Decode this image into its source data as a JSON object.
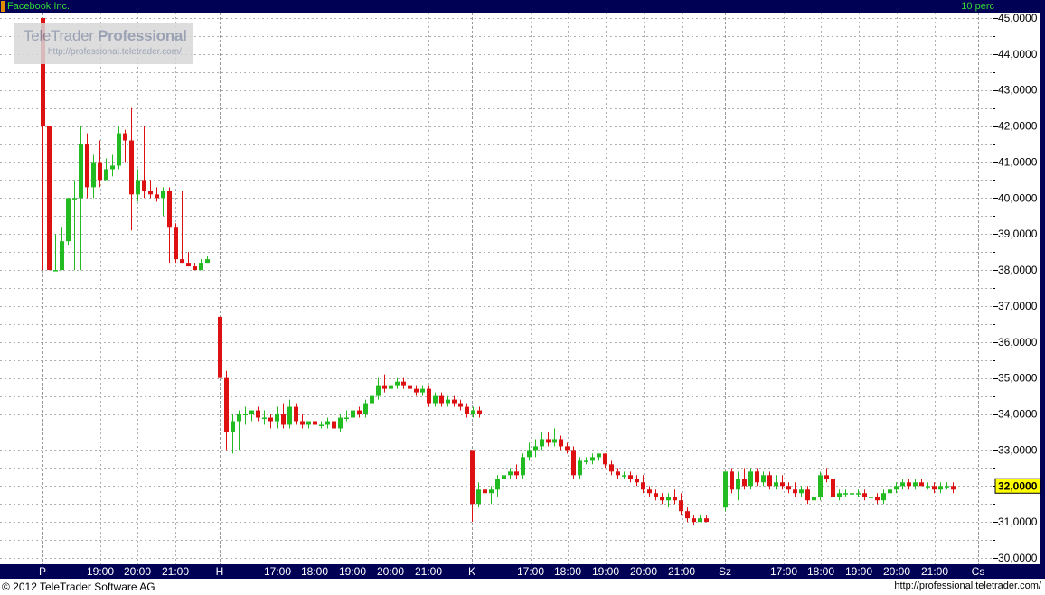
{
  "window": {
    "title": "Facebook Inc.",
    "scale_label": "10 perc",
    "copyright": "© 2012 TeleTrader Software AG",
    "site_url": "http://professional.teletrader.com/"
  },
  "watermark": {
    "brand": "TeleTrader",
    "brand_bold": "Professional",
    "url": "http://professional.teletrader.com/"
  },
  "colors": {
    "up": "#22bb22",
    "down": "#dd1111",
    "frame": "#000055",
    "grid": "#b0b0b0",
    "title_text": "#33dd33"
  },
  "chart_data": {
    "type": "candlestick",
    "title": "Facebook Inc.",
    "interval": "10 perc",
    "ylim": [
      30,
      45
    ],
    "y_ticks": [
      "30,0000",
      "31,0000",
      "32,0000",
      "33,0000",
      "34,0000",
      "35,0000",
      "36,0000",
      "37,0000",
      "38,0000",
      "39,0000",
      "40,0000",
      "41,0000",
      "42,0000",
      "43,0000",
      "44,0000",
      "45,0000"
    ],
    "last_price_label": "32,0000",
    "last_price": 32.0,
    "grid": true,
    "x_labels": [
      "P",
      "19:00",
      "20:00",
      "21:00",
      "H",
      "17:00",
      "18:00",
      "19:00",
      "20:00",
      "21:00",
      "K",
      "17:00",
      "18:00",
      "19:00",
      "20:00",
      "21:00",
      "Sz",
      "17:00",
      "18:00",
      "19:00",
      "20:00",
      "21:00",
      "Cs"
    ],
    "session_dividers": [
      "P",
      "H",
      "K",
      "Sz",
      "Cs"
    ],
    "sessions": [
      {
        "start_label": "P",
        "first_index": 0,
        "candles": [
          [
            45.0,
            45.0,
            38.0,
            42.0
          ],
          [
            42.0,
            42.0,
            38.0,
            38.0
          ],
          [
            38.0,
            39.0,
            38.0,
            38.0
          ],
          [
            38.0,
            39.2,
            38.0,
            38.8
          ],
          [
            38.8,
            40.0,
            38.7,
            40.0
          ],
          [
            40.0,
            40.5,
            38.0,
            40.0
          ],
          [
            40.0,
            42.0,
            38.0,
            41.5
          ],
          [
            41.5,
            41.8,
            40.0,
            40.3
          ],
          [
            40.3,
            41.2,
            40.0,
            41.0
          ],
          [
            41.0,
            41.6,
            40.3,
            40.5
          ],
          [
            40.5,
            41.1,
            40.6,
            40.8
          ],
          [
            40.8,
            41.2,
            40.6,
            40.9
          ],
          [
            40.9,
            42.0,
            40.8,
            41.8
          ],
          [
            41.8,
            41.9,
            41.0,
            41.6
          ],
          [
            41.6,
            42.5,
            39.1,
            40.1
          ],
          [
            40.1,
            40.8,
            39.9,
            40.5
          ],
          [
            40.5,
            42.0,
            40.0,
            40.2
          ],
          [
            40.2,
            40.5,
            40.0,
            40.1
          ],
          [
            40.1,
            40.3,
            39.9,
            40.0
          ],
          [
            40.0,
            40.3,
            39.5,
            40.2
          ],
          [
            40.2,
            40.3,
            38.2,
            39.2
          ],
          [
            39.2,
            39.3,
            38.2,
            38.3
          ],
          [
            38.3,
            40.2,
            38.2,
            38.2
          ],
          [
            38.2,
            38.5,
            38.1,
            38.1
          ],
          [
            38.1,
            38.2,
            38.0,
            38.0
          ],
          [
            38.0,
            38.3,
            38.0,
            38.2
          ],
          [
            38.2,
            38.4,
            38.2,
            38.3
          ]
        ]
      },
      {
        "start_label": "H",
        "first_index": 0,
        "candles": [
          [
            36.7,
            36.7,
            35.0,
            35.0
          ],
          [
            35.0,
            35.2,
            33.0,
            33.5
          ],
          [
            33.5,
            34.0,
            32.9,
            33.8
          ],
          [
            33.8,
            34.1,
            33.0,
            34.0
          ],
          [
            34.0,
            34.2,
            33.7,
            34.0
          ],
          [
            34.0,
            34.1,
            33.8,
            34.1
          ],
          [
            34.1,
            34.2,
            33.8,
            33.9
          ],
          [
            33.9,
            34.1,
            33.7,
            33.9
          ],
          [
            33.9,
            34.0,
            33.6,
            33.8
          ],
          [
            33.8,
            34.2,
            33.6,
            34.0
          ],
          [
            34.0,
            34.3,
            33.6,
            33.7
          ],
          [
            33.7,
            34.4,
            33.6,
            34.2
          ],
          [
            34.2,
            34.3,
            33.7,
            33.8
          ],
          [
            33.8,
            34.0,
            33.6,
            33.7
          ],
          [
            33.7,
            33.8,
            33.6,
            33.8
          ],
          [
            33.8,
            33.9,
            33.6,
            33.7
          ],
          [
            33.7,
            33.8,
            33.6,
            33.7
          ],
          [
            33.7,
            33.9,
            33.6,
            33.8
          ],
          [
            33.8,
            33.9,
            33.5,
            33.6
          ],
          [
            33.6,
            34.0,
            33.5,
            33.9
          ],
          [
            33.9,
            34.1,
            33.8,
            33.9
          ],
          [
            33.9,
            34.2,
            33.8,
            34.1
          ],
          [
            34.1,
            34.2,
            33.9,
            34.0
          ],
          [
            34.0,
            34.4,
            33.9,
            34.3
          ],
          [
            34.3,
            34.6,
            34.2,
            34.5
          ],
          [
            34.5,
            35.0,
            34.4,
            34.8
          ],
          [
            34.8,
            35.1,
            34.6,
            34.7
          ],
          [
            34.7,
            34.9,
            34.5,
            34.8
          ],
          [
            34.8,
            35.0,
            34.7,
            34.9
          ],
          [
            34.9,
            35.0,
            34.7,
            34.8
          ],
          [
            34.8,
            34.9,
            34.6,
            34.7
          ],
          [
            34.7,
            34.8,
            34.5,
            34.6
          ],
          [
            34.6,
            34.8,
            34.5,
            34.7
          ],
          [
            34.7,
            34.8,
            34.2,
            34.3
          ],
          [
            34.3,
            34.6,
            34.2,
            34.5
          ],
          [
            34.5,
            34.6,
            34.2,
            34.3
          ],
          [
            34.3,
            34.5,
            34.2,
            34.4
          ],
          [
            34.4,
            34.5,
            34.2,
            34.3
          ],
          [
            34.3,
            34.4,
            34.1,
            34.2
          ],
          [
            34.2,
            34.3,
            33.9,
            34.0
          ],
          [
            34.0,
            34.2,
            33.9,
            34.1
          ],
          [
            34.1,
            34.2,
            33.9,
            34.0
          ]
        ]
      },
      {
        "start_label": "K",
        "first_index": 0,
        "candles": [
          [
            33.0,
            33.0,
            31.0,
            31.5
          ],
          [
            31.5,
            32.1,
            31.4,
            31.9
          ],
          [
            31.9,
            32.1,
            31.5,
            31.8
          ],
          [
            31.8,
            32.0,
            31.5,
            31.9
          ],
          [
            31.9,
            32.3,
            31.7,
            32.2
          ],
          [
            32.2,
            32.5,
            32.0,
            32.3
          ],
          [
            32.3,
            32.5,
            32.2,
            32.4
          ],
          [
            32.4,
            32.6,
            32.2,
            32.3
          ],
          [
            32.3,
            32.9,
            32.2,
            32.8
          ],
          [
            32.8,
            33.2,
            32.7,
            33.0
          ],
          [
            33.0,
            33.3,
            32.8,
            33.1
          ],
          [
            33.1,
            33.5,
            33.0,
            33.3
          ],
          [
            33.3,
            33.5,
            33.1,
            33.2
          ],
          [
            33.2,
            33.6,
            33.1,
            33.3
          ],
          [
            33.3,
            33.4,
            33.0,
            33.1
          ],
          [
            33.1,
            33.2,
            32.9,
            33.0
          ],
          [
            33.0,
            33.1,
            32.2,
            32.3
          ],
          [
            32.3,
            32.8,
            32.2,
            32.7
          ],
          [
            32.7,
            32.8,
            32.6,
            32.7
          ],
          [
            32.7,
            32.9,
            32.6,
            32.8
          ],
          [
            32.8,
            32.9,
            32.7,
            32.9
          ],
          [
            32.9,
            32.9,
            32.5,
            32.6
          ],
          [
            32.6,
            32.7,
            32.3,
            32.4
          ],
          [
            32.4,
            32.5,
            32.2,
            32.3
          ],
          [
            32.3,
            32.4,
            32.2,
            32.3
          ],
          [
            32.3,
            32.4,
            32.1,
            32.2
          ],
          [
            32.2,
            32.3,
            32.0,
            32.1
          ],
          [
            32.1,
            32.3,
            31.8,
            31.9
          ],
          [
            31.9,
            32.0,
            31.7,
            31.8
          ],
          [
            31.8,
            31.9,
            31.6,
            31.7
          ],
          [
            31.7,
            31.8,
            31.5,
            31.6
          ],
          [
            31.6,
            31.8,
            31.4,
            31.7
          ],
          [
            31.7,
            31.9,
            31.5,
            31.6
          ],
          [
            31.6,
            31.8,
            31.2,
            31.3
          ],
          [
            31.3,
            31.4,
            31.0,
            31.1
          ],
          [
            31.1,
            31.2,
            30.9,
            31.0
          ],
          [
            31.0,
            31.2,
            31.0,
            31.1
          ],
          [
            31.1,
            31.2,
            31.0,
            31.0
          ]
        ]
      },
      {
        "start_label": "Sz",
        "first_index": 0,
        "candles": [
          [
            31.4,
            32.4,
            31.3,
            32.4
          ],
          [
            32.4,
            32.5,
            31.8,
            31.9
          ],
          [
            31.9,
            32.4,
            31.6,
            32.2
          ],
          [
            32.2,
            32.5,
            31.9,
            32.0
          ],
          [
            32.0,
            32.5,
            31.9,
            32.4
          ],
          [
            32.4,
            32.5,
            32.0,
            32.1
          ],
          [
            32.1,
            32.4,
            32.0,
            32.3
          ],
          [
            32.3,
            32.4,
            31.9,
            32.0
          ],
          [
            32.0,
            32.3,
            31.9,
            32.1
          ],
          [
            32.1,
            32.3,
            31.9,
            32.0
          ],
          [
            32.0,
            32.1,
            31.8,
            31.9
          ],
          [
            31.9,
            32.1,
            31.7,
            31.8
          ],
          [
            31.8,
            32.0,
            31.7,
            31.9
          ],
          [
            31.9,
            32.0,
            31.5,
            31.6
          ],
          [
            31.6,
            32.1,
            31.5,
            31.7
          ],
          [
            31.7,
            32.4,
            31.6,
            32.3
          ],
          [
            32.3,
            32.5,
            32.1,
            32.2
          ],
          [
            32.2,
            32.3,
            31.6,
            31.7
          ],
          [
            31.7,
            31.9,
            31.6,
            31.8
          ],
          [
            31.8,
            31.9,
            31.7,
            31.8
          ],
          [
            31.8,
            31.9,
            31.7,
            31.8
          ],
          [
            31.8,
            31.9,
            31.7,
            31.8
          ],
          [
            31.8,
            31.9,
            31.6,
            31.7
          ],
          [
            31.7,
            31.8,
            31.6,
            31.7
          ],
          [
            31.7,
            31.8,
            31.5,
            31.6
          ],
          [
            31.6,
            31.9,
            31.5,
            31.8
          ],
          [
            31.8,
            32.0,
            31.7,
            31.9
          ],
          [
            31.9,
            32.1,
            31.8,
            32.0
          ],
          [
            32.0,
            32.2,
            31.9,
            32.1
          ],
          [
            32.1,
            32.2,
            31.9,
            32.0
          ],
          [
            32.0,
            32.2,
            31.9,
            32.1
          ],
          [
            32.1,
            32.2,
            32.0,
            32.0
          ],
          [
            32.0,
            32.1,
            31.9,
            32.0
          ],
          [
            32.0,
            32.1,
            31.8,
            31.9
          ],
          [
            31.9,
            32.1,
            31.8,
            32.0
          ],
          [
            32.0,
            32.1,
            31.9,
            32.0
          ],
          [
            32.0,
            32.1,
            31.8,
            31.9
          ]
        ]
      }
    ]
  }
}
